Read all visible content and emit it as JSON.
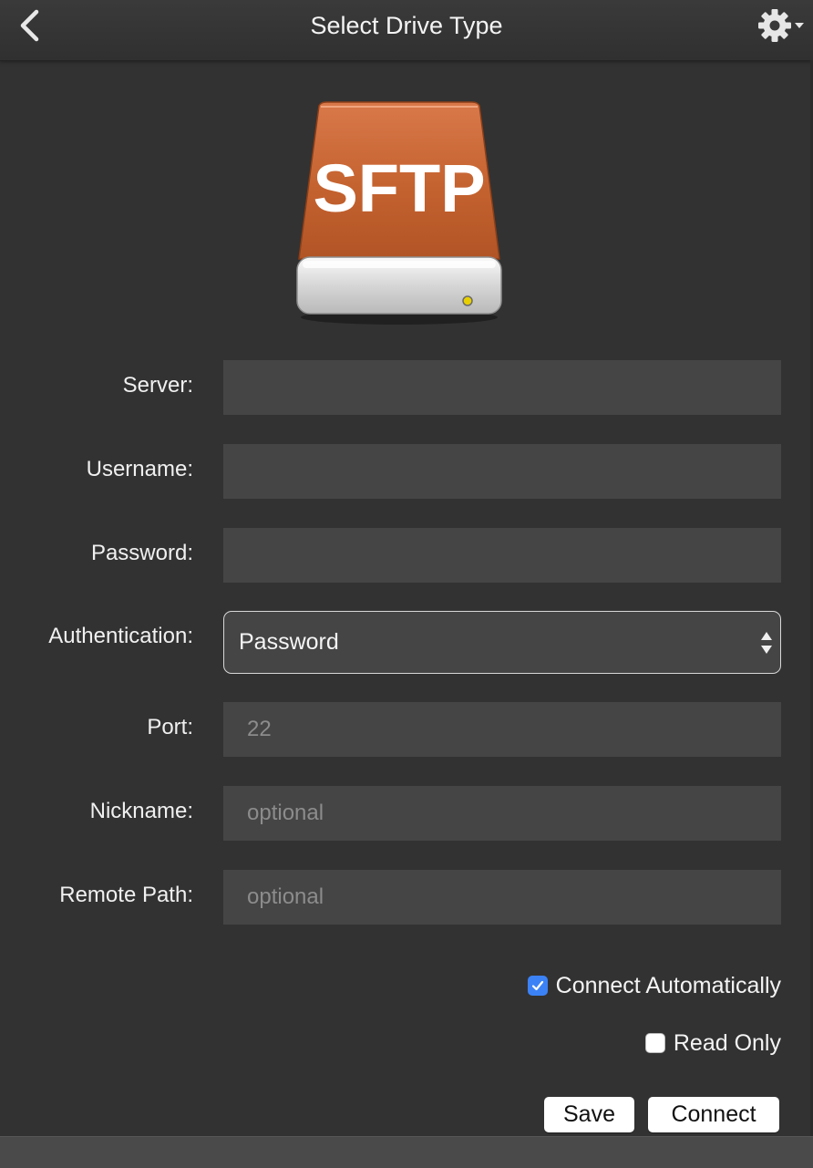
{
  "header": {
    "title": "Select Drive Type",
    "back_icon": "chevron-left-icon",
    "settings_icon": "gear-icon"
  },
  "drive": {
    "label": "SFTP",
    "icon": "external-drive-icon",
    "color": "#c8693a"
  },
  "form": {
    "server": {
      "label": "Server:",
      "value": "",
      "placeholder": ""
    },
    "username": {
      "label": "Username:",
      "value": "",
      "placeholder": ""
    },
    "password": {
      "label": "Password:",
      "value": "",
      "placeholder": ""
    },
    "authentication": {
      "label": "Authentication:",
      "selected": "Password"
    },
    "port": {
      "label": "Port:",
      "value": "",
      "placeholder": "22"
    },
    "nickname": {
      "label": "Nickname:",
      "value": "",
      "placeholder": "optional"
    },
    "remote_path": {
      "label": "Remote Path:",
      "value": "",
      "placeholder": "optional"
    }
  },
  "options": {
    "connect_automatically": {
      "label": "Connect Automatically",
      "checked": true
    },
    "read_only": {
      "label": "Read Only",
      "checked": false
    }
  },
  "actions": {
    "save_label": "Save",
    "connect_label": "Connect"
  },
  "colors": {
    "background": "#323232",
    "field": "#454545",
    "accent": "#3b82f6"
  }
}
